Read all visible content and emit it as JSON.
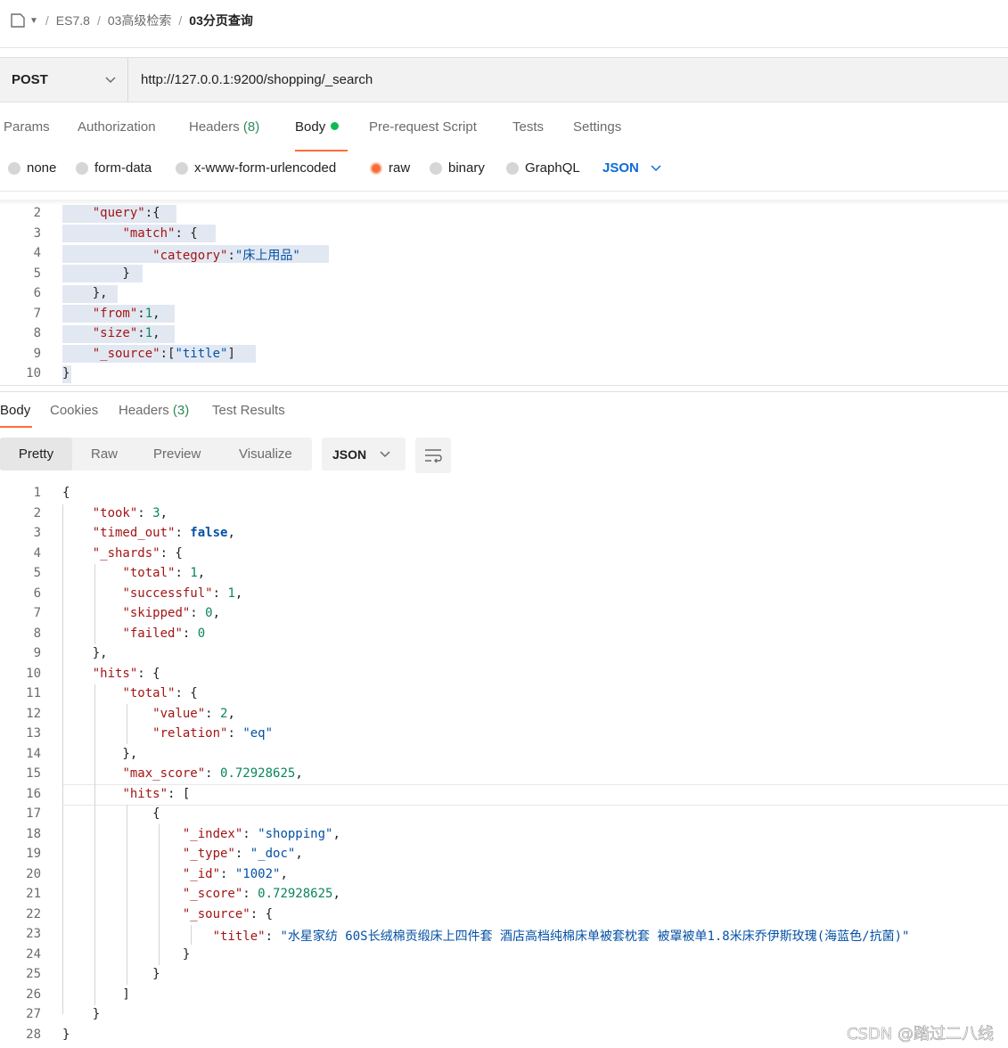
{
  "breadcrumb": {
    "items": [
      "ES7.8",
      "03高级检索"
    ],
    "current": "03分页查询"
  },
  "request": {
    "method": "POST",
    "url": "http://127.0.0.1:9200/shopping/_search",
    "tabs": [
      {
        "label": "Params"
      },
      {
        "label": "Authorization"
      },
      {
        "label": "Headers",
        "count": "(8)"
      },
      {
        "label": "Body"
      },
      {
        "label": "Pre-request Script"
      },
      {
        "label": "Tests"
      },
      {
        "label": "Settings"
      }
    ],
    "body_types": [
      "none",
      "form-data",
      "x-www-form-urlencoded",
      "raw",
      "binary",
      "GraphQL"
    ],
    "selected_body_type": "raw",
    "format": "JSON"
  },
  "request_code": [
    {
      "ln": "2",
      "text": "    \"query\":{"
    },
    {
      "ln": "3",
      "text": "        \"match\": {"
    },
    {
      "ln": "4",
      "text": "            \"category\":\"床上用品\""
    },
    {
      "ln": "5",
      "text": "        }"
    },
    {
      "ln": "6",
      "text": "    },"
    },
    {
      "ln": "7",
      "text": "    \"from\":1,"
    },
    {
      "ln": "8",
      "text": "    \"size\":1,"
    },
    {
      "ln": "9",
      "text": "    \"_source\":[\"title\"]"
    },
    {
      "ln": "10",
      "text": "}"
    }
  ],
  "response": {
    "tabs": [
      {
        "label": "Body"
      },
      {
        "label": "Cookies"
      },
      {
        "label": "Headers",
        "count": "(3)"
      },
      {
        "label": "Test Results"
      }
    ],
    "views": [
      "Pretty",
      "Raw",
      "Preview",
      "Visualize"
    ],
    "format": "JSON"
  },
  "response_code": [
    {
      "ln": "1",
      "text": "{"
    },
    {
      "ln": "2",
      "text": "    \"took\": 3,"
    },
    {
      "ln": "3",
      "text": "    \"timed_out\": false,"
    },
    {
      "ln": "4",
      "text": "    \"_shards\": {"
    },
    {
      "ln": "5",
      "text": "        \"total\": 1,"
    },
    {
      "ln": "6",
      "text": "        \"successful\": 1,"
    },
    {
      "ln": "7",
      "text": "        \"skipped\": 0,"
    },
    {
      "ln": "8",
      "text": "        \"failed\": 0"
    },
    {
      "ln": "9",
      "text": "    },"
    },
    {
      "ln": "10",
      "text": "    \"hits\": {"
    },
    {
      "ln": "11",
      "text": "        \"total\": {"
    },
    {
      "ln": "12",
      "text": "            \"value\": 2,"
    },
    {
      "ln": "13",
      "text": "            \"relation\": \"eq\""
    },
    {
      "ln": "14",
      "text": "        },"
    },
    {
      "ln": "15",
      "text": "        \"max_score\": 0.72928625,"
    },
    {
      "ln": "16",
      "text": "        \"hits\": ["
    },
    {
      "ln": "17",
      "text": "            {"
    },
    {
      "ln": "18",
      "text": "                \"_index\": \"shopping\","
    },
    {
      "ln": "19",
      "text": "                \"_type\": \"_doc\","
    },
    {
      "ln": "20",
      "text": "                \"_id\": \"1002\","
    },
    {
      "ln": "21",
      "text": "                \"_score\": 0.72928625,"
    },
    {
      "ln": "22",
      "text": "                \"_source\": {"
    },
    {
      "ln": "23",
      "text": "                    \"title\": \"水星家纺 60S长绒棉贡缎床上四件套 酒店高档纯棉床单被套枕套 被罩被单1.8米床乔伊斯玫瑰(海蓝色/抗菌)\""
    },
    {
      "ln": "24",
      "text": "                }"
    },
    {
      "ln": "25",
      "text": "            }"
    },
    {
      "ln": "26",
      "text": "        ]"
    },
    {
      "ln": "27",
      "text": "    }"
    },
    {
      "ln": "28",
      "text": "}"
    }
  ],
  "watermark": "CSDN @踏过二八线",
  "colors": {
    "accent": "#ff6c37",
    "status_green": "#0cbb52",
    "json_key": "#a31515",
    "json_string": "#0451a5",
    "json_number": "#098658",
    "link": "#0c6bd9"
  }
}
